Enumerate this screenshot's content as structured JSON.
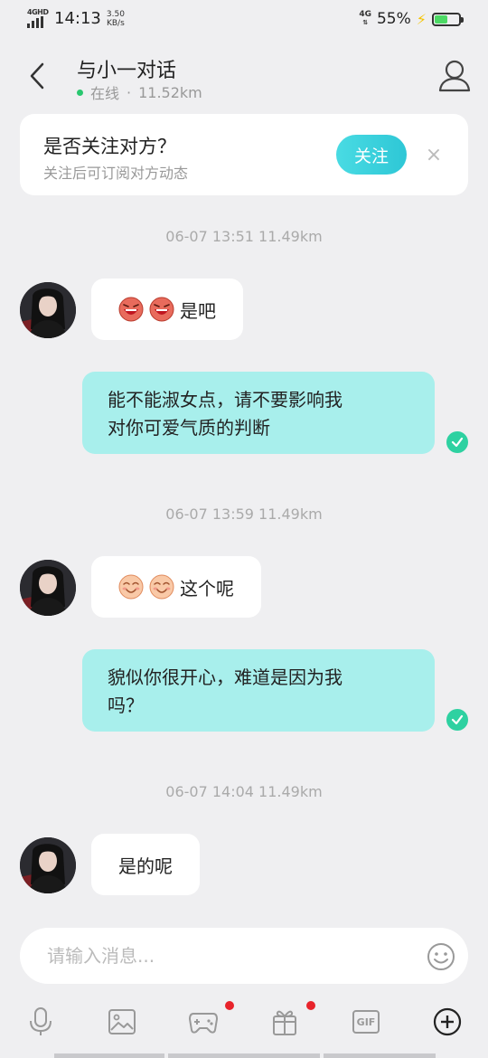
{
  "status_bar": {
    "network_label": "4GHD",
    "time": "14:13",
    "speed_value": "3.50",
    "speed_unit": "KB/s",
    "right_network": "4G",
    "battery_percent": "55%",
    "battery_level": 0.55
  },
  "header": {
    "title": "与小一对话",
    "status": "在线",
    "separator": "·",
    "distance": "11.52km"
  },
  "follow_card": {
    "title": "是否关注对方？",
    "subtitle": "关注后可订阅对方动态",
    "button_label": "关注",
    "close_label": "×"
  },
  "messages": [
    {
      "timestamp": "06-07 13:51  11.49km"
    },
    {
      "direction": "in",
      "emojis": [
        "laughing-face",
        "laughing-face"
      ],
      "text": "是吧"
    },
    {
      "direction": "out",
      "line1": "能不能淑女点，请不要影响我",
      "line2": "对你可爱气质的判断",
      "read": true
    },
    {
      "timestamp": "06-07 13:59  11.49km"
    },
    {
      "direction": "in",
      "emojis": [
        "smiling-face",
        "smiling-face"
      ],
      "text": "这个呢"
    },
    {
      "direction": "out",
      "line1": "貌似你很开心，难道是因为我",
      "line2": "吗？",
      "read": true
    },
    {
      "timestamp": "06-07 14:04  11.49km"
    },
    {
      "direction": "in",
      "text": "是的呢"
    }
  ],
  "input": {
    "placeholder": "请输入消息..."
  },
  "toolbar": {
    "items": [
      "microphone-icon",
      "image-icon",
      "game-icon",
      "gift-icon",
      "gif-icon",
      "plus-icon"
    ],
    "gif_label": "GIF"
  },
  "colors": {
    "outgoing_bubble": "#a8efec",
    "accent": "#2ec7d6",
    "online": "#29c76f",
    "read_check": "#2ed1a1",
    "badge": "#e8232b"
  }
}
